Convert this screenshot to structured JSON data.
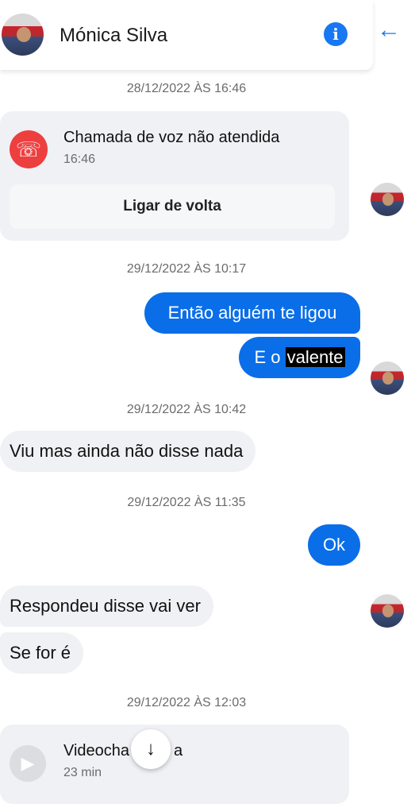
{
  "header": {
    "name": "Mónica Silva",
    "info_icon": "info-icon",
    "back_icon": "back-arrow-icon",
    "info_glyph": "i",
    "back_glyph": "←"
  },
  "accent_color": "#1877f2",
  "timestamps": [
    "28/12/2022 ÀS 16:46",
    "29/12/2022 ÀS 10:17",
    "29/12/2022 ÀS 10:42",
    "29/12/2022 ÀS 11:35",
    "29/12/2022 ÀS 12:03"
  ],
  "missed_call": {
    "title": "Chamada de voz não atendida",
    "time": "16:46",
    "button": "Ligar de volta",
    "icon": "missed-call-icon"
  },
  "messages": {
    "out1": "Então alguém te ligou",
    "out2_prefix": "E o ",
    "out2_highlight": "valente",
    "in1": "Viu mas ainda não disse nada",
    "out3": "Ok",
    "in2": "Respondeu disse vai ver",
    "in3": "Se for é"
  },
  "video_call": {
    "title_visible": "Videocha",
    "title_tail": "a",
    "duration": "23 min",
    "icon": "video-call-icon"
  },
  "scroll_down": {
    "icon": "arrow-down-icon",
    "glyph": "↓"
  }
}
